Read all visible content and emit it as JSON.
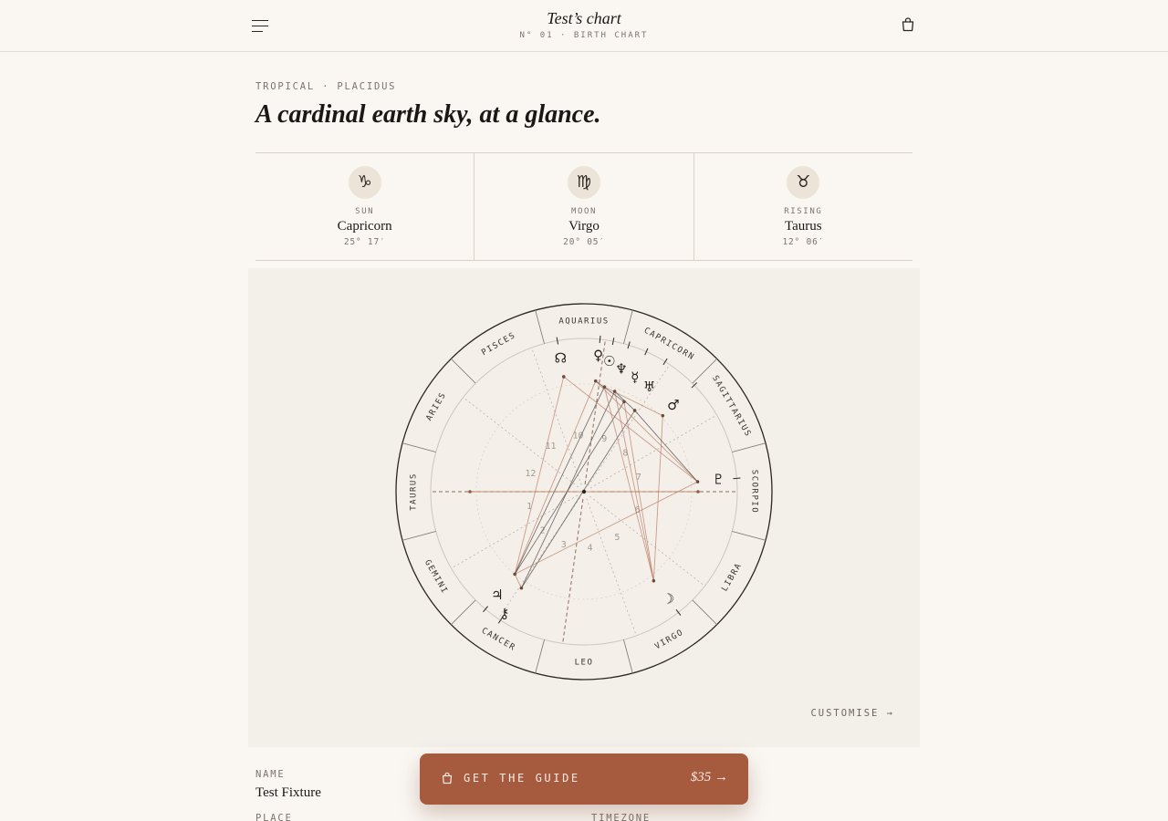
{
  "header": {
    "title": "Test’s chart",
    "subtitle": "N° 01 · BIRTH CHART",
    "menu_icon": "menu-icon",
    "bag_icon": "shopping-bag-icon"
  },
  "intro": {
    "eyebrow": "TROPICAL · PLACIDUS",
    "headline": "A cardinal earth sky, at a glance."
  },
  "big_three": [
    {
      "label": "SUN",
      "glyph": "♑",
      "sign": "Capricorn",
      "degree": "25° 17′"
    },
    {
      "label": "MOON",
      "glyph": "♍",
      "sign": "Virgo",
      "degree": "20° 05′"
    },
    {
      "label": "RISING",
      "glyph": "♉",
      "sign": "Taurus",
      "degree": "12° 06′"
    }
  ],
  "chart": {
    "signs": [
      "AQUARIUS",
      "CAPRICORN",
      "SAGITTARIUS",
      "SCORPIO",
      "LIBRA",
      "VIRGO",
      "LEO",
      "CANCER",
      "GEMINI",
      "TAURUS",
      "ARIES",
      "PISCES"
    ],
    "houses": [
      "1",
      "2",
      "3",
      "4",
      "5",
      "6",
      "7",
      "8",
      "9",
      "10",
      "11",
      "12"
    ],
    "planets": [
      {
        "name": "north-node",
        "glyph": "☊"
      },
      {
        "name": "venus",
        "glyph": "♀"
      },
      {
        "name": "sun",
        "glyph": "☉"
      },
      {
        "name": "neptune",
        "glyph": "♆"
      },
      {
        "name": "mercury",
        "glyph": "☿"
      },
      {
        "name": "uranus",
        "glyph": "♅"
      },
      {
        "name": "mars",
        "glyph": "♂"
      },
      {
        "name": "pluto",
        "glyph": "♇"
      },
      {
        "name": "moon",
        "glyph": "☽"
      },
      {
        "name": "jupiter",
        "glyph": "♃"
      },
      {
        "name": "chiron",
        "glyph": "⚷"
      }
    ],
    "colors": {
      "ring": "#2a2622",
      "aspect_warm": "#b87a62",
      "aspect_dark": "#4a4440",
      "panel": "#f3efe9"
    },
    "customise_label": "CUSTOMISE →"
  },
  "details": {
    "name_label": "NAME",
    "name_value": "Test Fixture",
    "place_label": "PLACE",
    "timezone_label": "TIMEZONE"
  },
  "cta": {
    "label": "GET THE GUIDE",
    "price": "$35 →",
    "icon": "shopping-bag-icon"
  }
}
